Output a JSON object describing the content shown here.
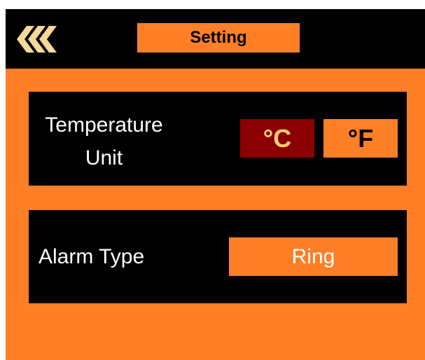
{
  "header": {
    "back_icon": "triple-chevron-left-icon",
    "title": "Setting"
  },
  "temperature": {
    "label_line1": "Temperature",
    "label_line2": "Unit",
    "options": [
      {
        "label": "°C",
        "selected": true
      },
      {
        "label": "°F",
        "selected": false
      }
    ]
  },
  "alarm": {
    "label": "Alarm Type",
    "value": "Ring"
  },
  "colors": {
    "background": "#ff7f27",
    "panel": "#000000",
    "selected_unit_bg": "#8b0000",
    "selected_unit_text": "#ffcc7a",
    "back_icon": "#f5d999"
  }
}
